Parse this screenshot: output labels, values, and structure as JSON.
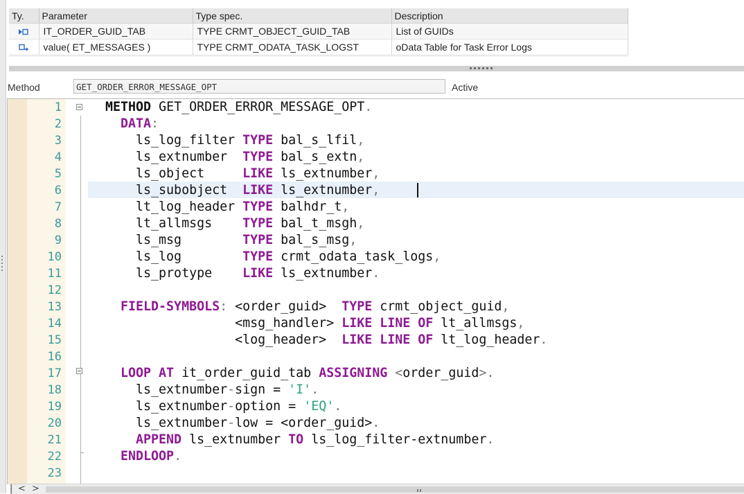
{
  "params": {
    "headers": [
      "Ty.",
      "Parameter",
      "Type spec.",
      "Description"
    ],
    "rows": [
      {
        "icon": "importing-parameter-icon",
        "parameter": "IT_ORDER_GUID_TAB",
        "type_spec": "TYPE CRMT_OBJECT_GUID_TAB",
        "description": "List of GUIDs"
      },
      {
        "icon": "returning-parameter-icon",
        "parameter": "value( ET_MESSAGES )",
        "type_spec": "TYPE CRMT_ODATA_TASK_LOGST",
        "description": "oData Table for Task Error Logs"
      }
    ]
  },
  "method_bar": {
    "label": "Method",
    "name": "GET_ORDER_ERROR_MESSAGE_OPT",
    "status": "Active"
  },
  "editor": {
    "current_line": 6,
    "lines": [
      {
        "n": "1",
        "tokens": [
          [
            "kw-m",
            "METHOD"
          ],
          [
            "",
            "GET_ORDER_ERROR_MESSAGE_OPT"
          ],
          [
            "pun",
            "."
          ]
        ],
        "indent": "",
        "sep": [
          " ",
          ""
        ]
      },
      {
        "n": "2",
        "indent": "  ",
        "tokens": [
          [
            "kw",
            "DATA"
          ],
          [
            "pun",
            ":"
          ]
        ]
      },
      {
        "n": "3",
        "indent": "    ",
        "tokens": [
          [
            "",
            "ls_log_filter "
          ],
          [
            "kw",
            "TYPE"
          ],
          [
            "",
            " bal_s_lfil"
          ],
          [
            "pun",
            ","
          ]
        ]
      },
      {
        "n": "4",
        "indent": "    ",
        "tokens": [
          [
            "",
            "ls_extnumber  "
          ],
          [
            "kw",
            "TYPE"
          ],
          [
            "",
            " bal_s_extn"
          ],
          [
            "pun",
            ","
          ]
        ]
      },
      {
        "n": "5",
        "indent": "    ",
        "tokens": [
          [
            "",
            "ls_object     "
          ],
          [
            "kw",
            "LIKE"
          ],
          [
            "",
            " ls_extnumber"
          ],
          [
            "pun",
            ","
          ]
        ]
      },
      {
        "n": "6",
        "indent": "    ",
        "tokens": [
          [
            "",
            "ls_subobject  "
          ],
          [
            "kw",
            "LIKE"
          ],
          [
            "",
            " ls_extnumber"
          ],
          [
            "pun",
            ","
          ]
        ]
      },
      {
        "n": "7",
        "indent": "    ",
        "tokens": [
          [
            "",
            "lt_log_header "
          ],
          [
            "kw",
            "TYPE"
          ],
          [
            "",
            " balhdr_t"
          ],
          [
            "pun",
            ","
          ]
        ]
      },
      {
        "n": "8",
        "indent": "    ",
        "tokens": [
          [
            "",
            "lt_allmsgs    "
          ],
          [
            "kw",
            "TYPE"
          ],
          [
            "",
            " bal_t_msgh"
          ],
          [
            "pun",
            ","
          ]
        ]
      },
      {
        "n": "9",
        "indent": "    ",
        "tokens": [
          [
            "",
            "ls_msg        "
          ],
          [
            "kw",
            "TYPE"
          ],
          [
            "",
            " bal_s_msg"
          ],
          [
            "pun",
            ","
          ]
        ]
      },
      {
        "n": "10",
        "indent": "    ",
        "tokens": [
          [
            "",
            "ls_log        "
          ],
          [
            "kw",
            "TYPE"
          ],
          [
            "",
            " crmt_odata_task_logs"
          ],
          [
            "pun",
            ","
          ]
        ]
      },
      {
        "n": "11",
        "indent": "    ",
        "tokens": [
          [
            "",
            "ls_protype    "
          ],
          [
            "kw",
            "LIKE"
          ],
          [
            "",
            " ls_extnumber"
          ],
          [
            "pun",
            "."
          ]
        ]
      },
      {
        "n": "12",
        "indent": "",
        "tokens": []
      },
      {
        "n": "13",
        "indent": "  ",
        "tokens": [
          [
            "kw",
            "FIELD-SYMBOLS"
          ],
          [
            "pun",
            ":"
          ],
          [
            "",
            " <order_guid>  "
          ],
          [
            "kw",
            "TYPE"
          ],
          [
            "",
            " crmt_object_guid"
          ],
          [
            "pun",
            ","
          ]
        ]
      },
      {
        "n": "14",
        "indent": "                 ",
        "tokens": [
          [
            "",
            "<msg_handler> "
          ],
          [
            "kw",
            "LIKE LINE OF"
          ],
          [
            "",
            " lt_allmsgs"
          ],
          [
            "pun",
            ","
          ]
        ]
      },
      {
        "n": "15",
        "indent": "                 ",
        "tokens": [
          [
            "",
            "<log_header>  "
          ],
          [
            "kw",
            "LIKE LINE OF"
          ],
          [
            "",
            " lt_log_header"
          ],
          [
            "pun",
            "."
          ]
        ]
      },
      {
        "n": "16",
        "indent": "",
        "tokens": []
      },
      {
        "n": "17",
        "indent": "  ",
        "tokens": [
          [
            "kw",
            "LOOP AT"
          ],
          [
            "",
            " it_order_guid_tab "
          ],
          [
            "kw",
            "ASSIGNING"
          ],
          [
            "",
            " "
          ],
          [
            "pun",
            "<"
          ],
          [
            "",
            "order_guid"
          ],
          [
            "pun",
            ">."
          ]
        ]
      },
      {
        "n": "18",
        "indent": "    ",
        "tokens": [
          [
            "",
            "ls_extnumber"
          ],
          [
            "pun",
            "-"
          ],
          [
            "",
            "sign = "
          ],
          [
            "str",
            "'I'"
          ],
          [
            "pun",
            "."
          ]
        ]
      },
      {
        "n": "19",
        "indent": "    ",
        "tokens": [
          [
            "",
            "ls_extnumber"
          ],
          [
            "pun",
            "-"
          ],
          [
            "",
            "option = "
          ],
          [
            "str",
            "'EQ'"
          ],
          [
            "pun",
            "."
          ]
        ]
      },
      {
        "n": "20",
        "indent": "    ",
        "tokens": [
          [
            "",
            "ls_extnumber"
          ],
          [
            "pun",
            "-"
          ],
          [
            "",
            "low = <order_guid>"
          ],
          [
            "pun",
            "."
          ]
        ]
      },
      {
        "n": "21",
        "indent": "    ",
        "tokens": [
          [
            "kw",
            "APPEND"
          ],
          [
            "",
            " ls_extnumber "
          ],
          [
            "kw",
            "TO"
          ],
          [
            "",
            " ls_log_filter-extnumber"
          ],
          [
            "pun",
            "."
          ]
        ]
      },
      {
        "n": "22",
        "indent": "  ",
        "tokens": [
          [
            "kw",
            "ENDLOOP"
          ],
          [
            "pun",
            "."
          ]
        ]
      },
      {
        "n": "23",
        "indent": "",
        "tokens": []
      }
    ]
  },
  "scrollbar": {
    "left_arrow": "<",
    "right_arrow": ">",
    "marker": "|"
  }
}
